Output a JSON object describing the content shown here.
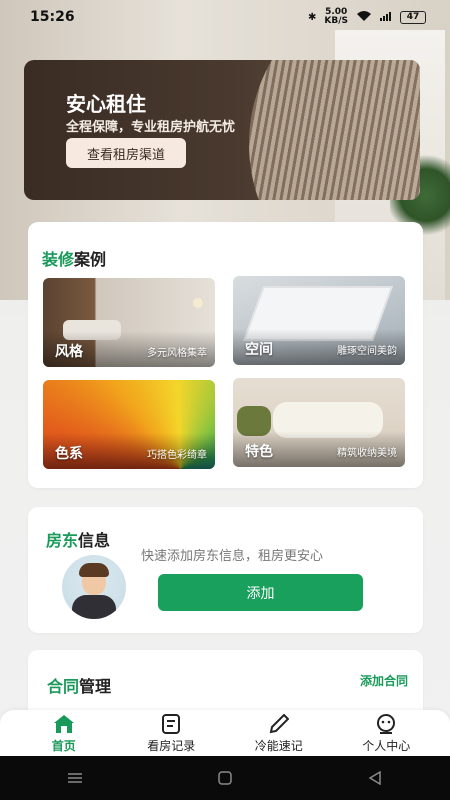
{
  "status_bar": {
    "time": "15:26",
    "net_speed_value": "5.00",
    "net_speed_unit": "KB/S",
    "battery": "47"
  },
  "hero": {
    "title": "安心租住",
    "subtitle": "全程保障，专业租房护航无忧",
    "button_label": "查看租房渠道"
  },
  "decor": {
    "title_accent": "装修",
    "title_rest": "案例",
    "tiles": [
      {
        "name": "风格",
        "desc": "多元风格集萃"
      },
      {
        "name": "空间",
        "desc": "雕琢空间美韵"
      },
      {
        "name": "色系",
        "desc": "巧搭色彩绮章"
      },
      {
        "name": "特色",
        "desc": "精筑收纳美境"
      }
    ]
  },
  "landlord": {
    "title_accent": "房东",
    "title_rest": "信息",
    "description": "快速添加房东信息，租房更安心",
    "button_label": "添加"
  },
  "contract": {
    "title_accent": "合同",
    "title_rest": "管理",
    "add_label": "添加合同"
  },
  "tabs": [
    {
      "label": "首页",
      "icon": "home-icon",
      "active": true
    },
    {
      "label": "看房记录",
      "icon": "record-icon",
      "active": false
    },
    {
      "label": "冷能速记",
      "icon": "pen-icon",
      "active": false
    },
    {
      "label": "个人中心",
      "icon": "profile-icon",
      "active": false
    }
  ],
  "colors": {
    "accent": "#1a9a5a",
    "button": "#1aa05d"
  }
}
